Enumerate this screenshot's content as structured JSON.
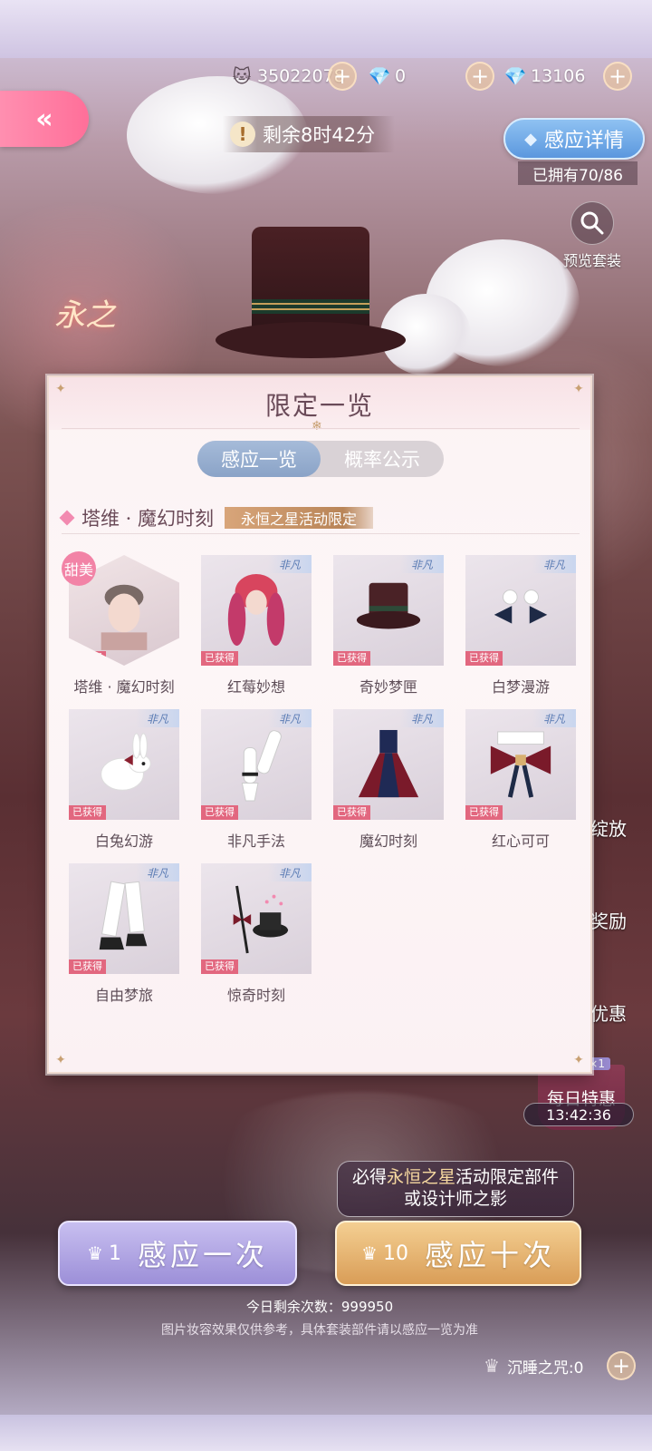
{
  "currencies": [
    {
      "icon": "cat-coin-icon",
      "glyph": "🐱",
      "value": "35022078"
    },
    {
      "icon": "diamond-icon",
      "glyph": "💎",
      "value": "0"
    },
    {
      "icon": "pink-diamond-icon",
      "glyph": "💎",
      "value": "13106"
    }
  ],
  "plus": "+",
  "back": "«",
  "timer": {
    "icon": "!",
    "text": "剩余8时42分"
  },
  "detail_button": {
    "label": "感应详情"
  },
  "owned": "已拥有70/86",
  "preview": {
    "label": "预览套装"
  },
  "emblem": "永之",
  "side": {
    "release": "绽放",
    "reward": "奖励",
    "discount": "优惠"
  },
  "daily_deal": {
    "title": "每日特惠",
    "badge": "×1",
    "timer": "13:42:36"
  },
  "panel": {
    "title": "限定一览",
    "tabs": [
      {
        "label": "感应一览",
        "active": true
      },
      {
        "label": "概率公示",
        "active": false
      }
    ],
    "section": {
      "title": "塔维 · 魔幻时刻",
      "tag": "永恒之星活动限定"
    },
    "corner_tag": "非凡",
    "got_badge": "已获得",
    "sweet_badge": "甜美",
    "items": [
      {
        "name": "塔维 · 魔幻时刻",
        "kind": "card"
      },
      {
        "name": "红莓妙想",
        "kind": "hair"
      },
      {
        "name": "奇妙梦匣",
        "kind": "hat"
      },
      {
        "name": "白梦漫游",
        "kind": "earring"
      },
      {
        "name": "白兔幻游",
        "kind": "rabbit"
      },
      {
        "name": "非凡手法",
        "kind": "gloves"
      },
      {
        "name": "魔幻时刻",
        "kind": "dress"
      },
      {
        "name": "红心可可",
        "kind": "bow"
      },
      {
        "name": "自由梦旅",
        "kind": "shoes"
      },
      {
        "name": "惊奇时刻",
        "kind": "magic-hat"
      }
    ]
  },
  "promo": {
    "line1_pre": "必得",
    "line1_hl": "永恒之星",
    "line1_post": "活动限定部件",
    "line2": "或设计师之影"
  },
  "buttons": {
    "once": {
      "count": "1",
      "label": "感应一次"
    },
    "ten": {
      "count": "10",
      "label": "感应十次"
    }
  },
  "remaining": "今日剩余次数：999950",
  "note": "图片妆容效果仅供参考，具体套装部件请以感应一览为准",
  "sleep": {
    "label": "沉睡之咒:0"
  },
  "colors": {
    "accent_pink": "#ff7fa6",
    "tab_active": "#8aa3c7",
    "gold": "#d99d57",
    "lilac": "#9c8fd8"
  }
}
